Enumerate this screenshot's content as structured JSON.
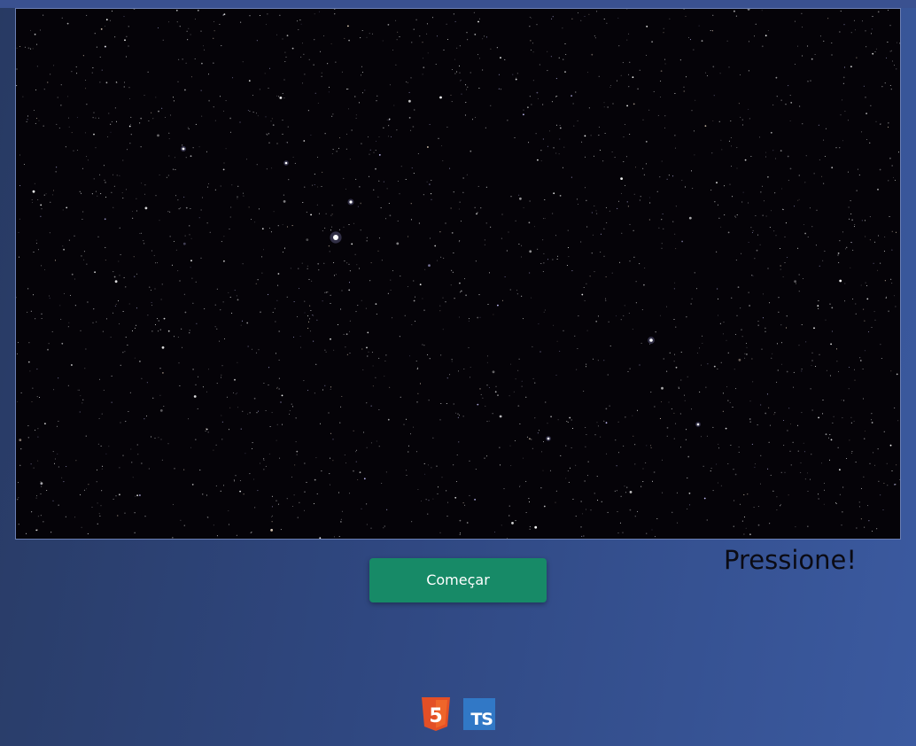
{
  "game": {
    "canvas_name": "starfield-game-canvas",
    "background_color": "#050308"
  },
  "controls": {
    "start_label": "Começar",
    "button_color": "#178a67"
  },
  "status": {
    "message": "Pressione!"
  },
  "footer": {
    "icons": [
      {
        "name": "html5-icon",
        "label": "5"
      },
      {
        "name": "typescript-icon",
        "label": "TS"
      }
    ]
  },
  "colors": {
    "page_gradient_start": "#283a63",
    "page_gradient_end": "#3b5aa0",
    "html5_orange": "#e34f26",
    "typescript_blue": "#3178c6"
  }
}
